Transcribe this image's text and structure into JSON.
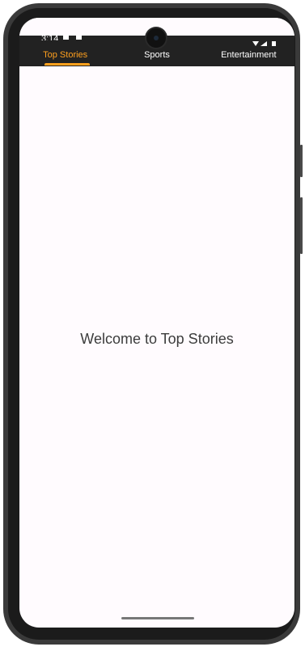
{
  "status_bar": {
    "time": "3:14"
  },
  "tabs": [
    {
      "label": "Top Stories",
      "active": true
    },
    {
      "label": "Sports",
      "active": false
    },
    {
      "label": "Entertainment",
      "active": false
    }
  ],
  "content": {
    "welcome_text": "Welcome to Top Stories"
  },
  "colors": {
    "accent": "#ffa01e",
    "app_bar": "#222222",
    "background": "#fffbfe"
  }
}
